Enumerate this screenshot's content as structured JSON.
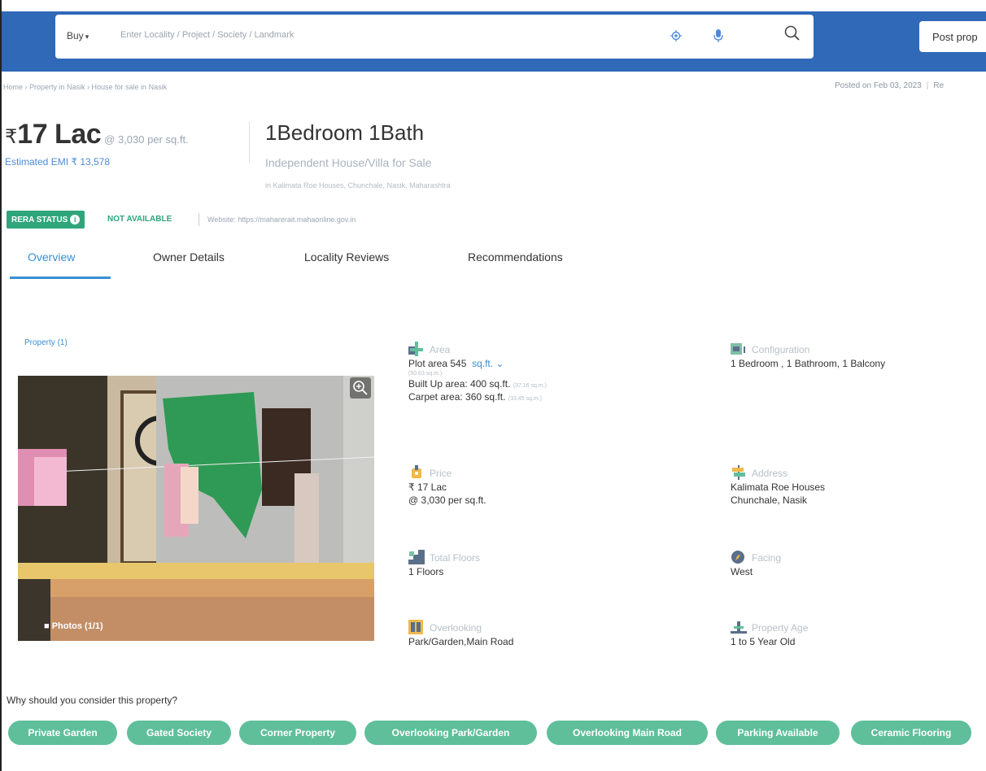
{
  "header": {
    "buy_label": "Buy",
    "search_placeholder": "Enter Locality / Project / Society / Landmark",
    "post_label": "Post prop"
  },
  "breadcrumb": {
    "text": "Home › Property in Nasik › House for sale in Nasik"
  },
  "posted": {
    "text": "Posted on Feb 03, 2023",
    "extra": "Re"
  },
  "price": {
    "currency": "₹",
    "amount": "17 Lac",
    "per_sqft": "@ 3,030 per sq.ft.",
    "emi": "Estimated EMI ₹ 13,578"
  },
  "listing": {
    "title": "1Bedroom 1Bath",
    "type": "Independent House/Villa for Sale",
    "location": "in Kalimata Roe Houses, Chunchale, Nasik, Maharashtra"
  },
  "rera": {
    "badge": "RERA STATUS",
    "status": "NOT AVAILABLE",
    "website": "Website: https://maharerait.mahaonline.gov.in"
  },
  "tabs": [
    {
      "label": "Overview"
    },
    {
      "label": "Owner Details"
    },
    {
      "label": "Locality Reviews"
    },
    {
      "label": "Recommendations"
    }
  ],
  "property_count": "Property (1)",
  "photos_label": "Photos (1/1)",
  "details": {
    "area": {
      "label": "Area",
      "plot": "Plot area 545",
      "plot_unit": "sq.ft.",
      "plot_sqm": "(50.63 sq.m.)",
      "built_up": "Built Up area: 400 sq.ft.",
      "built_up_sqm": "(37.16 sq.m.)",
      "carpet": "Carpet area: 360 sq.ft.",
      "carpet_sqm": "(33.45 sq.m.)"
    },
    "configuration": {
      "label": "Configuration",
      "value": "1 Bedroom , 1 Bathroom, 1 Balcony"
    },
    "price": {
      "label": "Price",
      "value": "₹ 17 Lac",
      "per": "@ 3,030 per sq.ft."
    },
    "address": {
      "label": "Address",
      "line1": "Kalimata Roe Houses",
      "line2": "Chunchale, Nasik"
    },
    "floors": {
      "label": "Total Floors",
      "value": "1 Floors"
    },
    "facing": {
      "label": "Facing",
      "value": "West"
    },
    "overlooking": {
      "label": "Overlooking",
      "value": "Park/Garden,Main Road"
    },
    "age": {
      "label": "Property Age",
      "value": "1 to 5 Year Old"
    }
  },
  "why": {
    "heading": "Why should you consider this property?",
    "tags": [
      "Private Garden",
      "Gated Society",
      "Corner Property",
      "Overlooking Park/Garden",
      "Overlooking Main Road",
      "Parking Available",
      "Ceramic Flooring"
    ]
  },
  "colors": {
    "header_blue": "#2f69b8",
    "accent_blue": "#3b8ed6",
    "tag_green": "#5fbf9b",
    "rera_green": "#2fa57c"
  }
}
